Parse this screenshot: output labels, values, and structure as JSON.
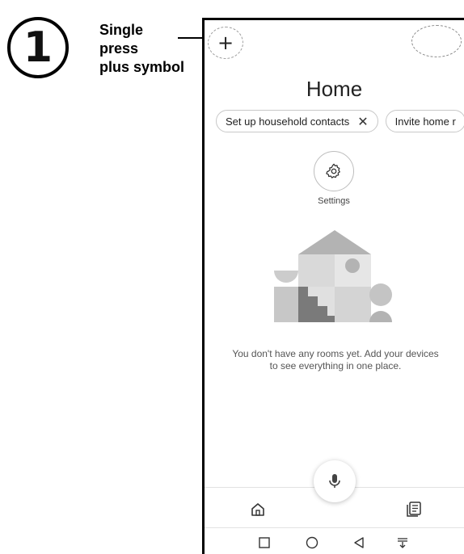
{
  "annotation": {
    "step_number": "1",
    "lines": [
      "Single",
      "press",
      "plus symbol"
    ]
  },
  "app": {
    "title": "Home",
    "chips": [
      {
        "label": "Set up household contacts",
        "has_close": true
      },
      {
        "label": "Invite home r",
        "has_close": false
      }
    ],
    "settings_label": "Settings",
    "empty_message": "You don't have any rooms yet. Add your devices to see everything in one place."
  },
  "icons": {
    "plus": "plus-icon",
    "avatar": "account-avatar",
    "settings": "gear-icon",
    "mic": "microphone-icon",
    "home": "home-icon",
    "feed": "feed-icon",
    "recents": "square-icon",
    "home_system": "circle-icon",
    "back": "triangle-back-icon",
    "notifications": "pull-down-icon"
  },
  "colors": {
    "illustration_dark": "#7a7a7a",
    "illustration_mid": "#b3b3b3",
    "illustration_light": "#d9d9d9"
  }
}
